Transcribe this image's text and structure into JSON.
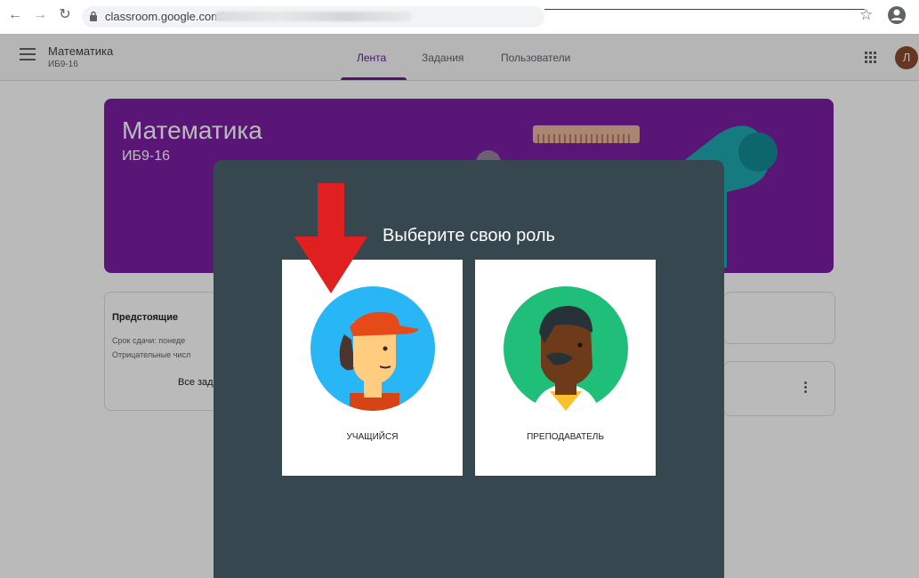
{
  "browser": {
    "url_visible": "classroom.google.com/",
    "back_icon": "arrow-left",
    "forward_icon": "arrow-right",
    "reload_icon": "reload",
    "lock_icon": "lock",
    "bookmark_icon": "star",
    "account_icon": "account-circle"
  },
  "header": {
    "course_name": "Математика",
    "course_section": "ИБ9-16",
    "tabs": [
      {
        "label": "Лента",
        "active": true
      },
      {
        "label": "Задания",
        "active": false
      },
      {
        "label": "Пользователи",
        "active": false
      }
    ],
    "avatar_letter": "Л"
  },
  "banner": {
    "title": "Математика",
    "subtitle": "ИБ9-16",
    "color": "#7b1fa2"
  },
  "upcoming": {
    "title": "Предстоящие",
    "due_text": "Срок сдачи: понеде",
    "task_text": "Отрицательные числ",
    "view_all": "Все зад"
  },
  "dialog": {
    "title": "Выберите свою роль",
    "background": "#37474f",
    "roles": [
      {
        "label": "УЧАЩИЙСЯ",
        "icon": "student-avatar-icon",
        "highlighted_by_arrow": true
      },
      {
        "label": "ПРЕПОДАВАТЕЛЬ",
        "icon": "teacher-avatar-icon"
      }
    ]
  },
  "colors": {
    "accent": "#6a1b9a",
    "arrow": "#e02020"
  }
}
